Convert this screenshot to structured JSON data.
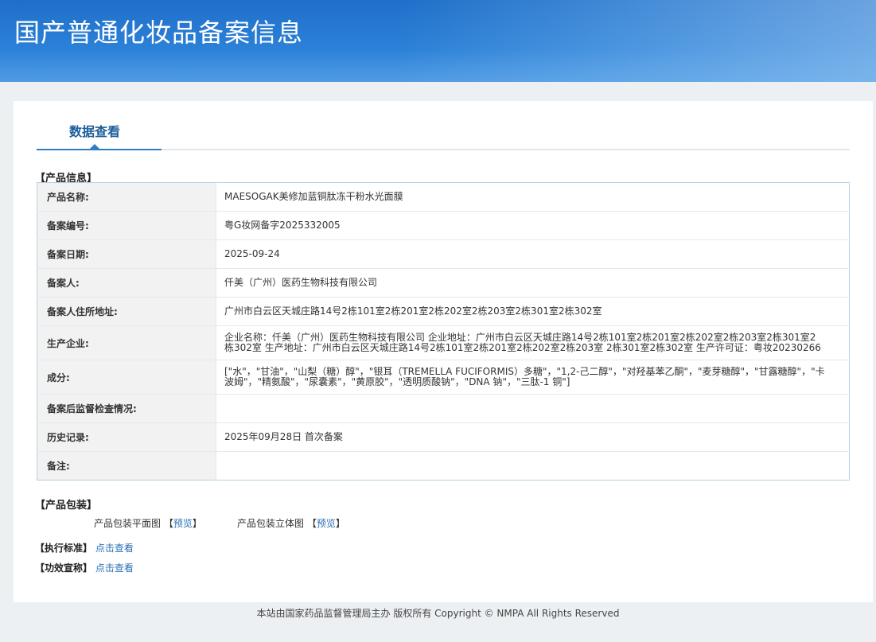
{
  "header": {
    "title": "国产普通化妆品备案信息"
  },
  "tabs": [
    {
      "label": "数据查看"
    }
  ],
  "product_info": {
    "heading": "【产品信息】",
    "rows": [
      {
        "label": "产品名称:",
        "value": "MAESOGAK美修加蓝铜肽冻干粉水光面膜"
      },
      {
        "label": "备案编号:",
        "value": "粤G妆网备字2025332005"
      },
      {
        "label": "备案日期:",
        "value": "2025-09-24"
      },
      {
        "label": "备案人:",
        "value": "仟美（广州）医药生物科技有限公司"
      },
      {
        "label": "备案人住所地址:",
        "value": "广州市白云区天城庄路14号2栋101室2栋201室2栋202室2栋203室2栋301室2栋302室"
      },
      {
        "label": "生产企业:",
        "value": "企业名称：仟美（广州）医药生物科技有限公司 企业地址：广州市白云区天城庄路14号2栋101室2栋201室2栋202室2栋203室2栋301室2栋302室 生产地址：广州市白云区天城庄路14号2栋101室2栋201室2栋202室2栋203室 2栋301室2栋302室 生产许可证：粤妆20230266"
      },
      {
        "label": "成分:",
        "value": "[\"水\"，\"甘油\"，\"山梨（糖）醇\"，\"银耳（TREMELLA FUCIFORMIS）多糖\"，\"1,2-己二醇\"，\"对羟基苯乙酮\"，\"麦芽糖醇\"，\"甘露糖醇\"，\"卡波姆\"，\"精氨酸\"，\"尿囊素\"，\"黄原胶\"，\"透明质酸钠\"，\"DNA 钠\"，\"三肽-1 铜\"]"
      },
      {
        "label": "备案后监督检查情况:",
        "value": ""
      },
      {
        "label": "历史记录:",
        "value": "2025年09月28日 首次备案"
      },
      {
        "label": "备注:",
        "value": ""
      }
    ]
  },
  "packaging": {
    "heading": "【产品包装】",
    "flat_label": "产品包装平面图",
    "flat_link": "预览",
    "solid_label": "产品包装立体图",
    "solid_link": "预览",
    "bracket_open": "【",
    "bracket_close": "】"
  },
  "standard": {
    "label": "【执行标准】",
    "link": "点击查看"
  },
  "efficacy": {
    "label": "【功效宣称】",
    "link": "点击查看"
  },
  "footer": {
    "text": "本站由国家药品监督管理局主办 版权所有 Copyright © NMPA All Rights Reserved"
  }
}
